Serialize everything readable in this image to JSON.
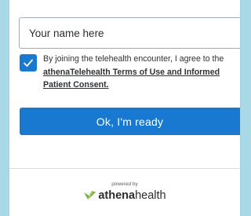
{
  "form": {
    "name_placeholder": "Your name here",
    "name_value": ""
  },
  "consent": {
    "checked": true,
    "text_prefix": "By joining the telehealth encounter, I agree to the ",
    "link_text": "athenaTelehealth Terms of Use and Informed Patient Consent.",
    "checkbox_icon": "checkmark-icon"
  },
  "actions": {
    "ready_label": "Ok, I'm ready"
  },
  "footer": {
    "powered_by": "powered by",
    "brand_prefix": "athena",
    "brand_suffix": "health",
    "logo_icon": "athena-leaf-logo"
  },
  "colors": {
    "accent": "#1978cf",
    "background": "#a9d9e6",
    "logo_green": "#7cb342"
  }
}
